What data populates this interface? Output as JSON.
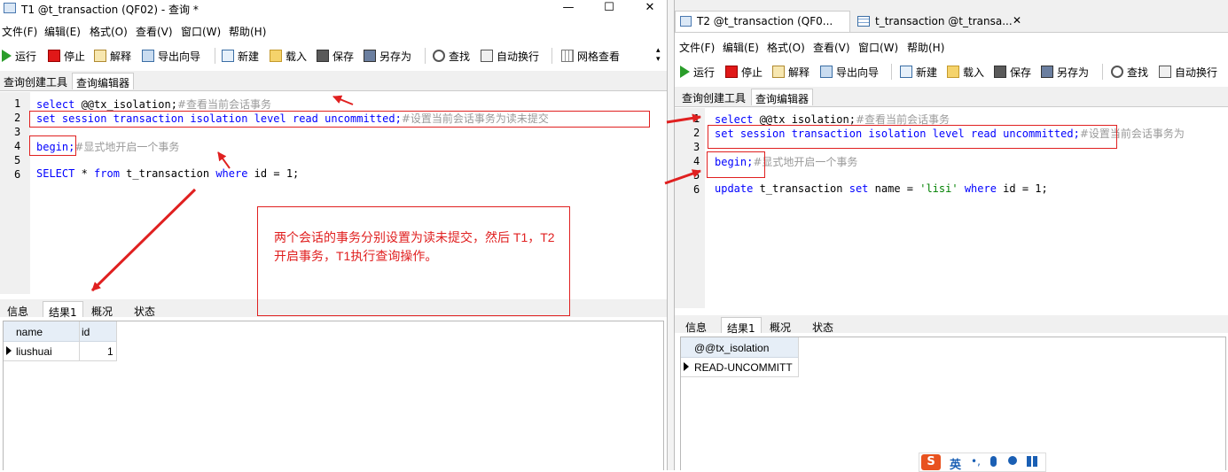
{
  "left": {
    "title": "T1 @t_transaction (QF02) - 查询 *",
    "menu": [
      "文件(F)",
      "编辑(E)",
      "格式(O)",
      "查看(V)",
      "窗口(W)",
      "帮助(H)"
    ],
    "toolbar": [
      "运行",
      "停止",
      "解释",
      "导出向导",
      "新建",
      "载入",
      "保存",
      "另存为",
      "查找",
      "自动换行",
      "网格查看"
    ],
    "subtabs": [
      "查询创建工具",
      "查询编辑器"
    ],
    "code": {
      "l1_kw": "select",
      "l1_rest": " @@tx_isolation;",
      "l1_cm": "#查看当前会话事务",
      "l2_kw": "set session transaction isolation level read uncommitted;",
      "l2_cm": "#设置当前会话事务为读未提交",
      "l4_kw": "begin;",
      "l4_cm": "#显式地开启一个事务",
      "l6_a": "SELECT",
      "l6_b": " * ",
      "l6_c": "from",
      "l6_d": " t_transaction ",
      "l6_e": "where",
      "l6_f": " id = ",
      "l6_g": "1",
      "l6_h": ";"
    },
    "line_numbers": [
      "1",
      "2",
      "3",
      "4",
      "5",
      "6"
    ],
    "annotation": "两个会话的事务分别设置为读未提交，然后 T1，T2 开启事务，T1执行查询操作。",
    "result_tabs": [
      "信息",
      "结果1",
      "概况",
      "状态"
    ],
    "result": {
      "headers": [
        "name",
        "id"
      ],
      "row": [
        "liushuai",
        "1"
      ]
    }
  },
  "right": {
    "tab1": "T2 @t_transaction (QF0...",
    "tab2": "t_transaction @t_transa...",
    "menu": [
      "文件(F)",
      "编辑(E)",
      "格式(O)",
      "查看(V)",
      "窗口(W)",
      "帮助(H)"
    ],
    "toolbar": [
      "运行",
      "停止",
      "解释",
      "导出向导",
      "新建",
      "载入",
      "保存",
      "另存为",
      "查找",
      "自动换行"
    ],
    "subtabs": [
      "查询创建工具",
      "查询编辑器"
    ],
    "code": {
      "l1_kw": "select",
      "l1_rest": " @@tx_isolation;",
      "l1_cm": "#查看当前会话事务",
      "l2_kw": "set session transaction isolation level read uncommitted;",
      "l2_cm": "#设置当前会话事务为",
      "l4_kw": "begin;",
      "l4_cm": "#显式地开启一个事务",
      "l6_a": "update",
      "l6_b": " t_transaction ",
      "l6_c": "set",
      "l6_d": " name = ",
      "l6_e": "'lisi'",
      "l6_f": " ",
      "l6_g": "where",
      "l6_h": " id = ",
      "l6_i": "1",
      "l6_j": ";"
    },
    "line_numbers": [
      "1",
      "2",
      "3",
      "4",
      "5",
      "6"
    ],
    "result_tabs": [
      "信息",
      "结果1",
      "概况",
      "状态"
    ],
    "result": {
      "headers": [
        "@@tx_isolation"
      ],
      "row": [
        "READ-UNCOMMITT"
      ]
    }
  },
  "ime": {
    "label": "英"
  },
  "colors": {
    "annotation_red": "#e02020",
    "keyword_blue": "#0000ff",
    "comment_gray": "#9a9a9a"
  }
}
